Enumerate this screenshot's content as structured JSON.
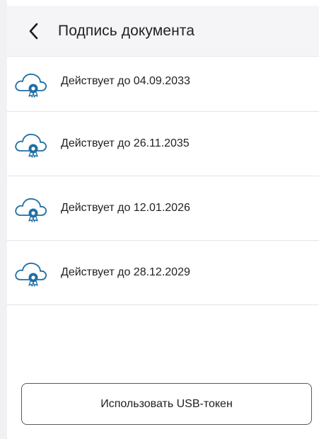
{
  "header": {
    "title": "Подпись документа",
    "back_icon": "chevron-left-icon"
  },
  "certificates": [
    {
      "label": "Действует до 04.09.2033",
      "icon": "cloud-certificate-icon"
    },
    {
      "label": "Действует до 26.11.2035",
      "icon": "cloud-certificate-icon"
    },
    {
      "label": "Действует до 12.01.2026",
      "icon": "cloud-certificate-icon"
    },
    {
      "label": "Действует до 28.12.2029",
      "icon": "cloud-certificate-icon"
    }
  ],
  "footer": {
    "usb_button_label": "Использовать USB-токен"
  },
  "colors": {
    "header_bg": "#f5f5f7",
    "icon_accent": "#1f6fa5",
    "divider": "#e4e4e4",
    "button_border": "#5a5a5a"
  }
}
